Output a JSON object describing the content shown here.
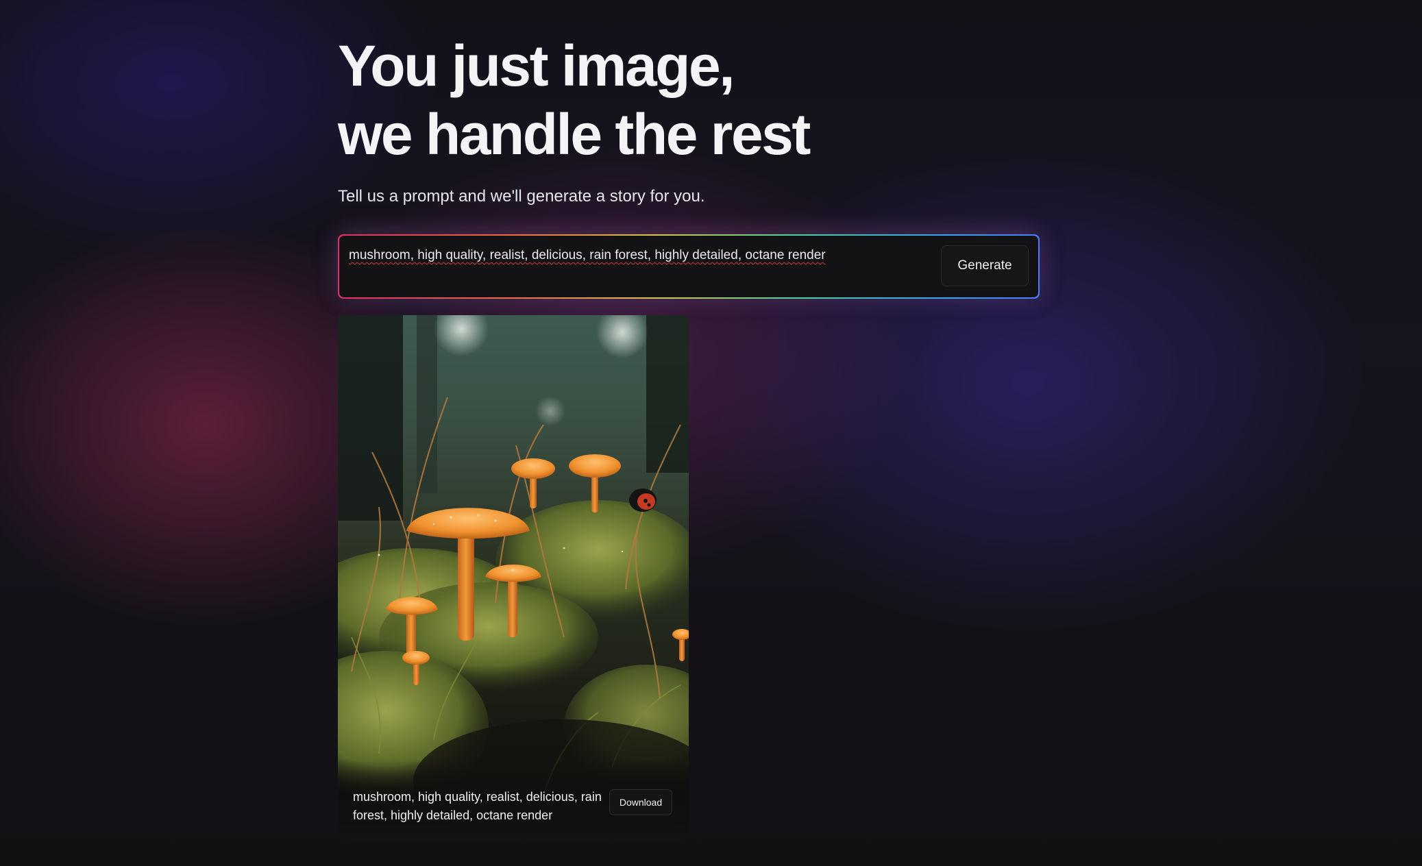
{
  "hero": {
    "headline_line1": "You just image,",
    "headline_line2": "we handle the rest",
    "subtitle": "Tell us a prompt and we'll generate a story for you."
  },
  "prompt": {
    "value": "mushroom, high quality, realist, delicious, rain forest, highly detailed, octane render",
    "generate_label": "Generate"
  },
  "result": {
    "caption": "mushroom, high quality, realist, delicious, rain forest, highly detailed, octane render",
    "download_label": "Download"
  },
  "colors": {
    "accent_gradient": [
      "#e0306a",
      "#d9c64a",
      "#4fd0a0",
      "#3aa5ee"
    ],
    "mushroom_cap": "#f0922e"
  }
}
